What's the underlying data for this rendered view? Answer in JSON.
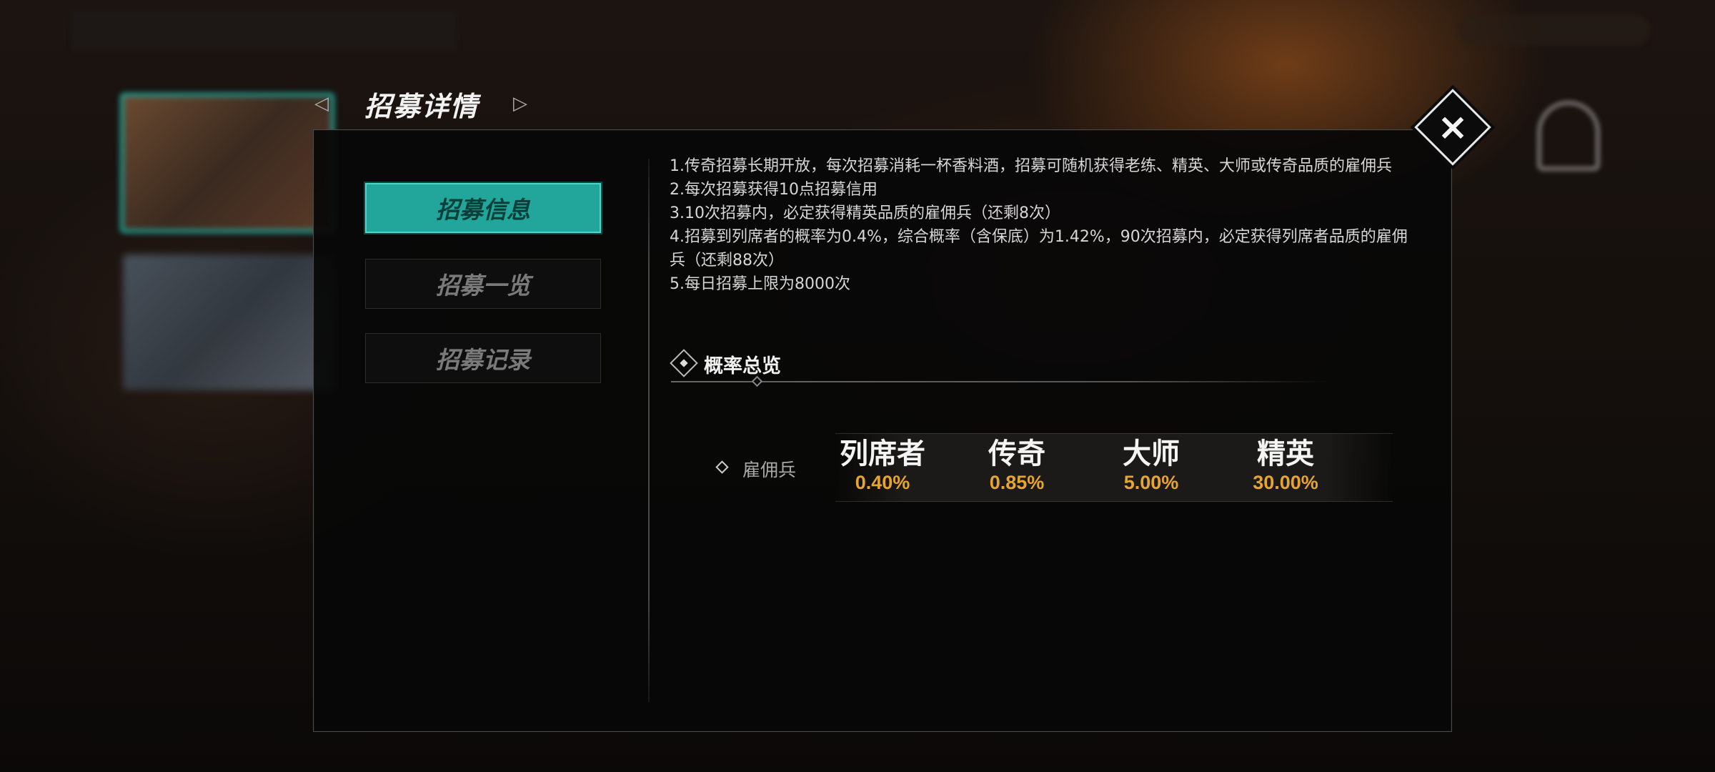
{
  "header": {
    "title": "招募详情",
    "prev_icon": "left-triangle-icon",
    "next_icon": "right-triangle-icon"
  },
  "close_icon": "×",
  "tabs": [
    {
      "label": "招募信息",
      "active": true
    },
    {
      "label": "招募一览",
      "active": false
    },
    {
      "label": "招募记录",
      "active": false
    }
  ],
  "rules": [
    "1.传奇招募长期开放，每次招募消耗一杯香料酒，招募可随机获得老练、精英、大师或传奇品质的雇佣兵",
    "2.每次招募获得10点招募信用",
    "3.10次招募内，必定获得精英品质的雇佣兵（还剩8次）",
    "4.招募到列席者的概率为0.4%，综合概率（含保底）为1.42%，90次招募内，必定获得列席者品质的雇佣兵（还剩88次）",
    "5.每日招募上限为8000次"
  ],
  "section": {
    "title": "概率总览"
  },
  "rates": {
    "row_label": "雇佣兵",
    "items": [
      {
        "name": "列席者",
        "value": "0.40%"
      },
      {
        "name": "传奇",
        "value": "0.85%"
      },
      {
        "name": "大师",
        "value": "5.00%"
      },
      {
        "name": "精英",
        "value": "30.00%"
      }
    ]
  },
  "colors": {
    "accent": "#22a69b",
    "rate_value": "#e7a42e"
  }
}
